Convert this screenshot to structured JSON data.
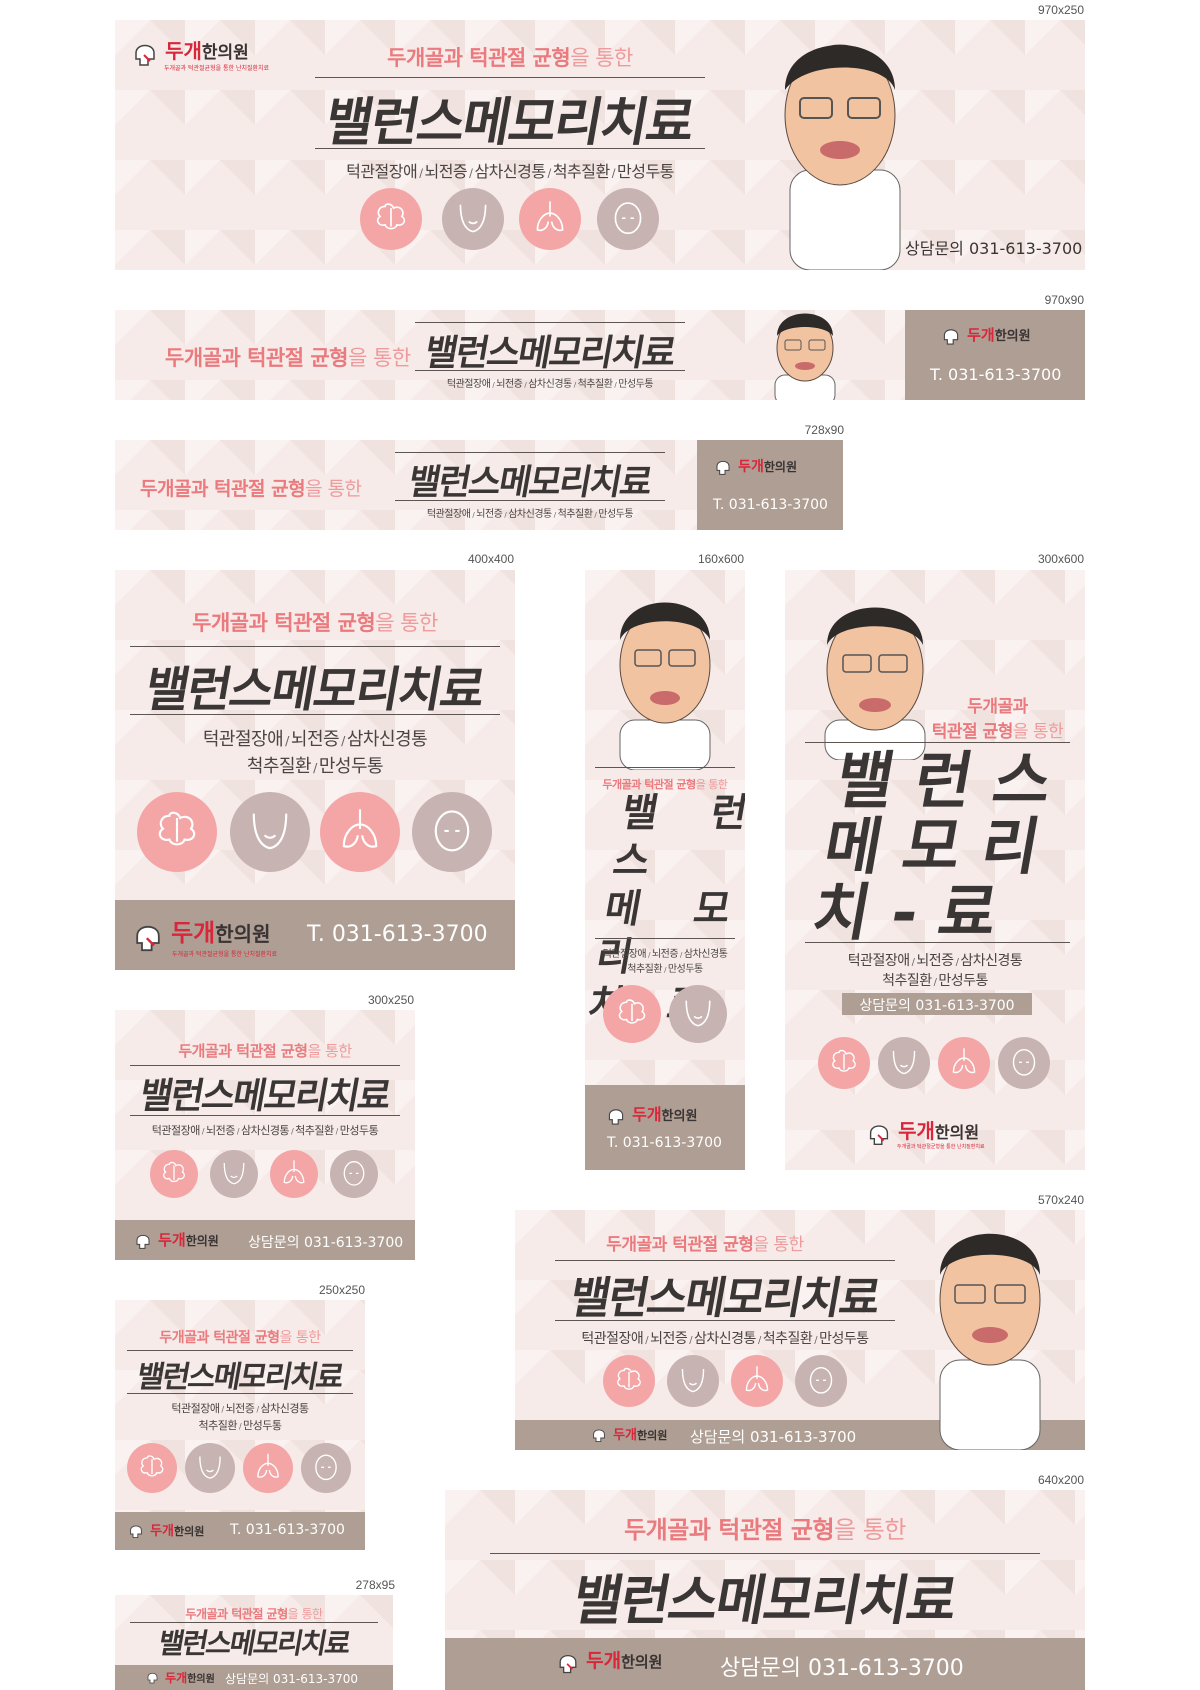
{
  "brand": {
    "name_red": "두개",
    "name_dark": "한의원",
    "tagline": "두개골과 턱관절균형을 통한 난치질환치료"
  },
  "headline": {
    "sub_a": "두개골과 턱관절 균형",
    "sub_b": "을 통한",
    "title": "밸런스메모리치료"
  },
  "conditions": [
    "턱관절장애",
    "뇌전증",
    "삼차신경통",
    "척추질환",
    "만성두통"
  ],
  "separator": "/",
  "phone": "T. 031-613-3700",
  "consult": "상담문의 031-613-3700",
  "vertical_title": {
    "row1": "밸 런 스",
    "row2": "메 모 리",
    "row3": "치 - 료"
  },
  "sub_300x600": {
    "line1": "두개골과",
    "line2a": "턱관절 균형",
    "line2b": "을 통한"
  },
  "consult_300x600": "상담문의  031-613-3700",
  "icons": [
    "brain-icon",
    "jaw-icon",
    "lungs-icon",
    "head-icon"
  ],
  "colors": {
    "pink": "#f4a6a7",
    "mauve": "#c7b3b1",
    "bar": "#ae9e93",
    "accent": "#ea7a7e",
    "logo_red": "#d8263a"
  },
  "sizes": {
    "s970x250": "970x250",
    "s970x90": "970x90",
    "s728x90": "728x90",
    "s400x400": "400x400",
    "s160x600": "160x600",
    "s300x600": "300x600",
    "s300x250": "300x250",
    "s570x240": "570x240",
    "s250x250": "250x250",
    "s640x200": "640x200",
    "s278x95": "278x95"
  }
}
